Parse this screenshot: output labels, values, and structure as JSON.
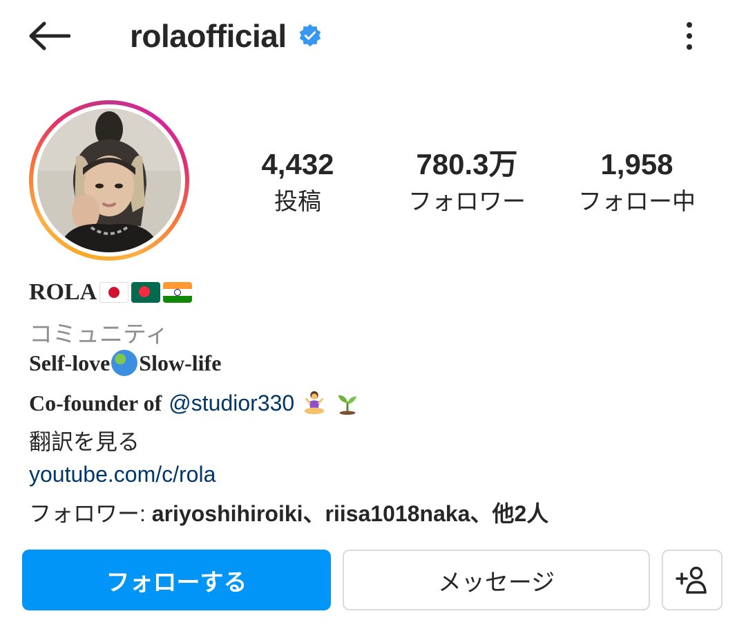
{
  "header": {
    "back_icon": "arrow-left-icon",
    "username": "rolaofficial",
    "verified_icon": "verified-badge-icon",
    "more_icon": "more-vertical-icon"
  },
  "stats": {
    "posts": {
      "value": "4,432",
      "label": "投稿"
    },
    "followers": {
      "value": "780.3万",
      "label": "フォロワー"
    },
    "following": {
      "value": "1,958",
      "label": "フォロー中"
    }
  },
  "bio": {
    "name": "ROLA",
    "name_flags": [
      "japan-flag",
      "bangladesh-flag",
      "india-flag"
    ],
    "category": "コミュニティ",
    "line1_a": "Self-love",
    "line1_emoji": "globe-emoji",
    "line1_b": "Slow-life",
    "line2_prefix": "Co-founder of",
    "line2_mention": "@studior330",
    "line2_emojis": [
      "meditation-emoji",
      "seedling-emoji"
    ],
    "translate": "翻訳を見る",
    "link": "youtube.com/c/rola",
    "followed_by_prefix": "フォロワー: ",
    "followed_by_names": "ariyoshihiroiki、riisa1018naka、他2人"
  },
  "actions": {
    "follow_label": "フォローする",
    "message_label": "メッセージ",
    "suggest_icon": "add-person-icon"
  },
  "colors": {
    "primary_blue": "#0095f6",
    "link_blue": "#00376b",
    "muted_gray": "#8e8e8e",
    "verified_blue": "#3897f0"
  }
}
